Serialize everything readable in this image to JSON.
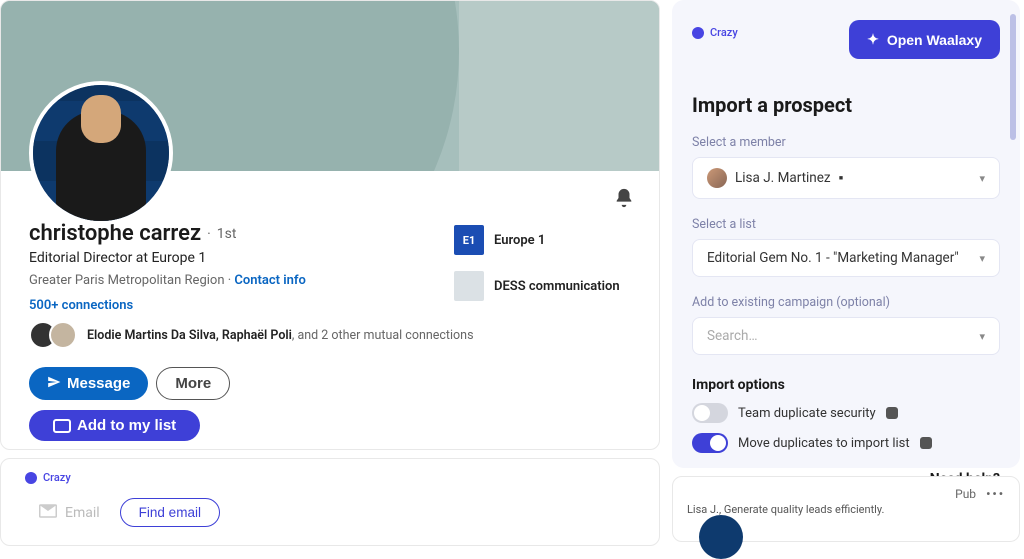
{
  "profile": {
    "name": "christophe carrez",
    "degree_separator": "·",
    "degree": "1st",
    "headline": "Editorial Director at Europe 1",
    "location": "Greater Paris Metropolitan Region",
    "separator": " · ",
    "contact_info": "Contact info",
    "connections": "500+ connections",
    "mutual_names": "Elodie Martins Da Silva, Raphaël Poli",
    "mutual_suffix": ", and 2 other mutual connections",
    "actions": {
      "message": "Message",
      "more": "More",
      "add_to_list": "Add to my list"
    },
    "associations": {
      "europe1": "Europe 1",
      "dess": "DESS communication"
    }
  },
  "email_widget": {
    "brand": "Crazy",
    "email_label": "Email",
    "find_email": "Find email"
  },
  "panel": {
    "brand": "Crazy",
    "open_btn": "Open Waalaxy",
    "title": "Import a prospect",
    "select_member_label": "Select a member",
    "member_name": "Lisa J. Martinez",
    "select_list_label": "Select a list",
    "list_name": "Editorial Gem No. 1 - \"Marketing Manager\"",
    "campaign_label": "Add to existing campaign (optional)",
    "search_placeholder": "Search…",
    "options_title": "Import options",
    "toggle_team": "Team duplicate security",
    "toggle_move": "Move duplicates to import list",
    "help": "Need help?"
  },
  "promo": {
    "tag": "Pub",
    "line": "Lisa J., Generate quality leads efficiently."
  }
}
